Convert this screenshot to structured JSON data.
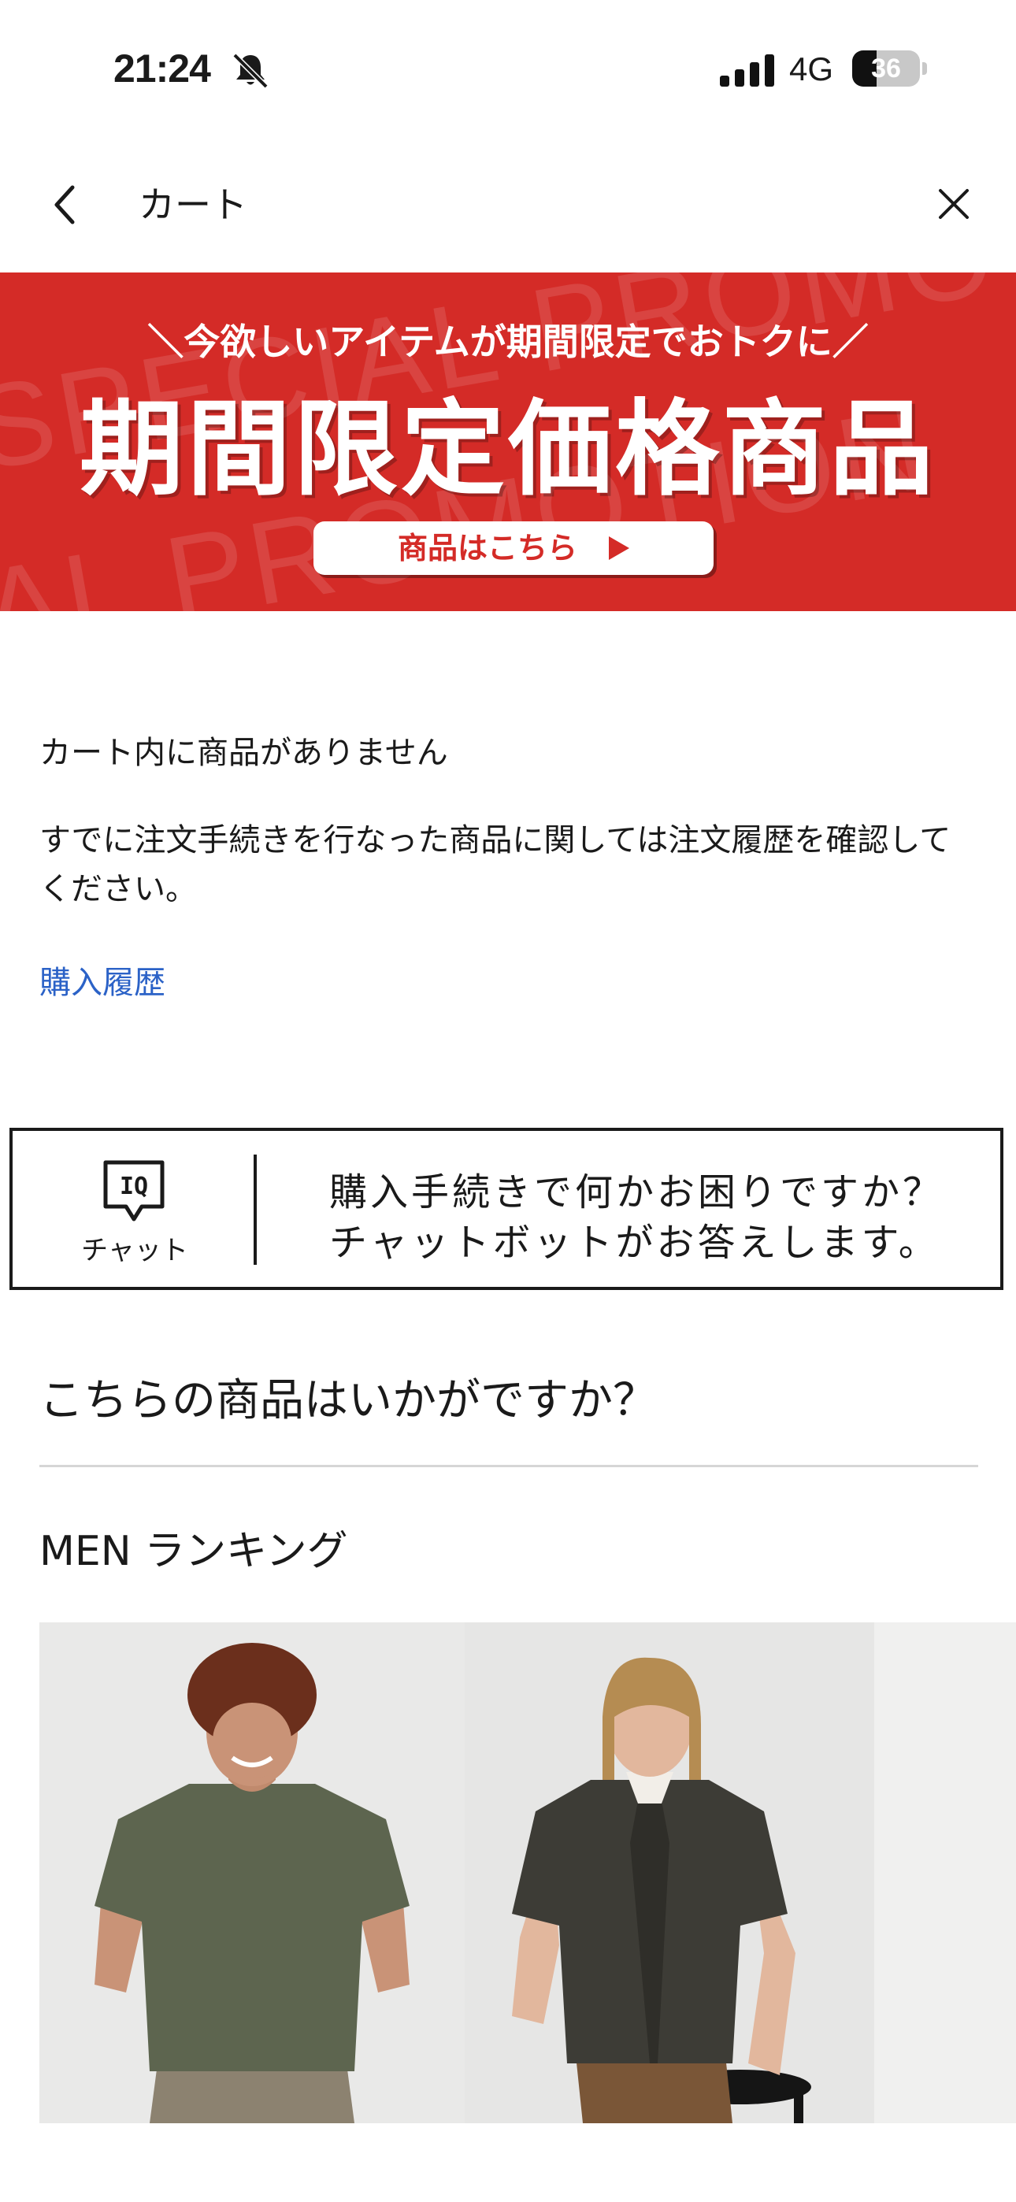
{
  "status_bar": {
    "time": "21:24",
    "network": "4G",
    "battery": "36",
    "battery_level": 0.36
  },
  "header": {
    "title": "カート"
  },
  "banner": {
    "watermark_1": "SPECIAL PROMO",
    "watermark_2": "AL PROMOTION",
    "tagline": "＼今欲しいアイテムが期間限定でおトクに／",
    "title": "期間限定価格商品",
    "button_label": "商品はこちら"
  },
  "cart": {
    "empty_message": "カート内に商品がありません",
    "hint": "すでに注文手続きを行なった商品に関しては注文履歴を確認してください。",
    "history_link": "購入履歴"
  },
  "chat": {
    "icon_text": "IQ",
    "label": "チャット",
    "line1": "購入手続きで何かお困りですか？",
    "line2": "チャットボットがお答えします。"
  },
  "recommend": {
    "title": "こちらの商品はいかがですか？",
    "subtitle": "MEN ランキング"
  },
  "colors": {
    "brand_red": "#d42b27",
    "link_blue": "#2b62c7"
  }
}
